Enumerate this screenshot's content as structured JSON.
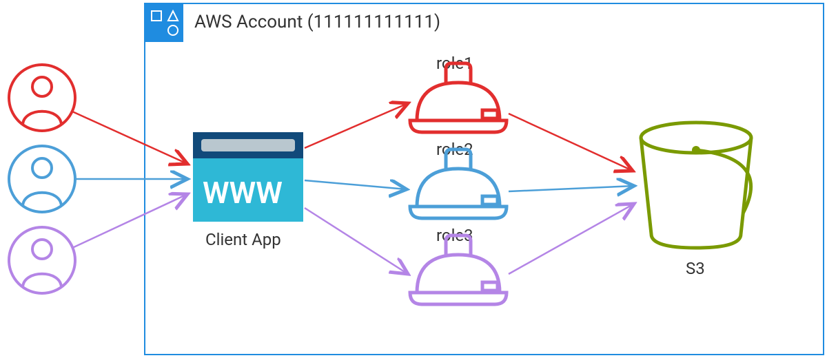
{
  "account": {
    "title": "AWS Account (111111111111)"
  },
  "users": [
    {
      "id": "user1",
      "color": "#E22E2E"
    },
    {
      "id": "user2",
      "color": "#4C9FD8"
    },
    {
      "id": "user3",
      "color": "#B485E6"
    }
  ],
  "clientApp": {
    "label": "Client App",
    "wwwText": "WWW"
  },
  "roles": [
    {
      "id": "role1",
      "label": "role1",
      "color": "#E22E2E"
    },
    {
      "id": "role2",
      "label": "role2",
      "color": "#4C9FD8"
    },
    {
      "id": "role3",
      "label": "role3",
      "color": "#B485E6"
    }
  ],
  "s3": {
    "label": "S3",
    "color": "#7A9A01"
  },
  "colors": {
    "accountBorder": "#1F8CE0",
    "appDark": "#114A7A",
    "appLight": "#2EB8D6"
  }
}
